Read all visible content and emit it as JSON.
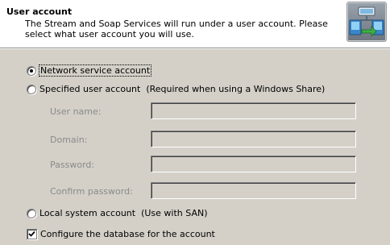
{
  "header": {
    "title": "User account",
    "description": "The Stream and Soap Services will run under a user account. Please select what user account you will use.",
    "icon": "network-services-icon"
  },
  "account_options": {
    "network_service": {
      "label": "Network service account",
      "checked": true
    },
    "specified_user": {
      "label": "Specified user account  (Required when using a Windows Share)",
      "checked": false
    },
    "local_system": {
      "label": "Local system account  (Use with SAN)",
      "checked": false
    }
  },
  "credentials": {
    "username_label": "User name:",
    "username_value": "",
    "domain_label": "Domain:",
    "domain_value": "",
    "password_label": "Password:",
    "password_value": "",
    "confirm_password_label": "Confirm password:",
    "confirm_password_value": "",
    "enabled": false
  },
  "configure_db": {
    "label": "Configure the database for the account",
    "checked": true
  }
}
